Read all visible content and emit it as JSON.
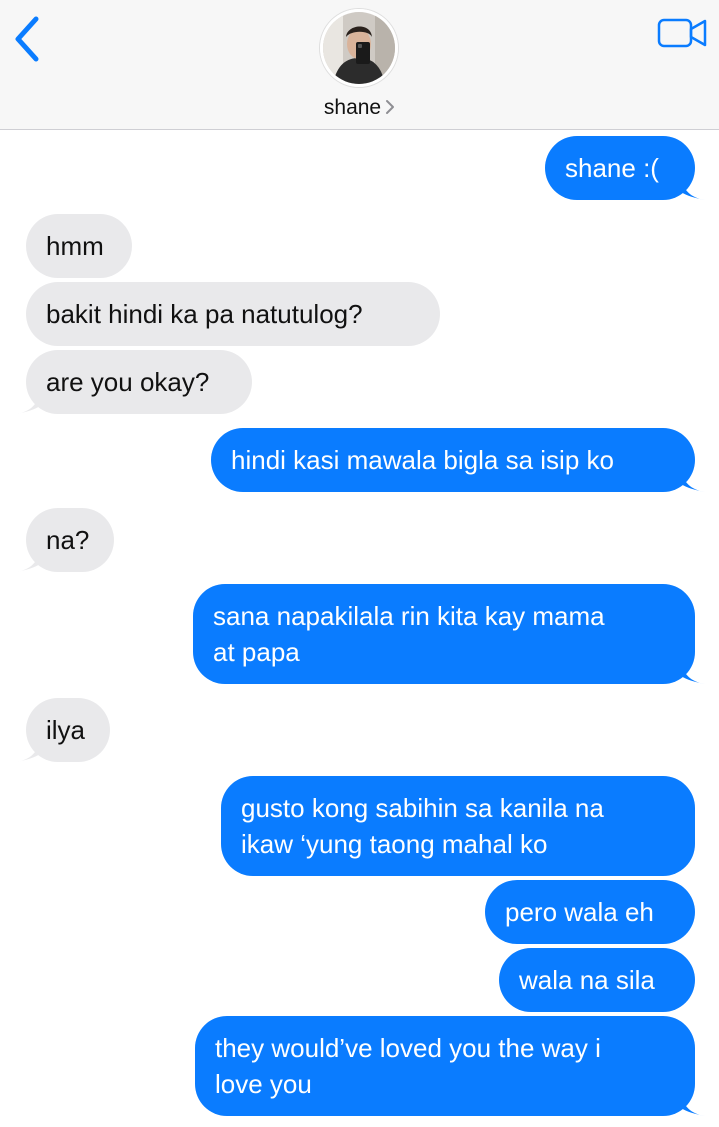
{
  "header": {
    "contact_name": "shane",
    "back_icon": "chevron-left-icon",
    "video_icon": "video-camera-icon",
    "accent_color": "#0a7cff"
  },
  "messages": [
    {
      "sender": "me",
      "text": "shane :("
    },
    {
      "sender": "them",
      "text": "hmm"
    },
    {
      "sender": "them",
      "text": "bakit hindi ka pa natutulog?"
    },
    {
      "sender": "them",
      "text": "are you okay?"
    },
    {
      "sender": "me",
      "text": "hindi kasi mawala bigla sa isip ko"
    },
    {
      "sender": "them",
      "text": "na?"
    },
    {
      "sender": "me",
      "text": "sana napakilala rin kita kay mama\nat papa"
    },
    {
      "sender": "them",
      "text": "ilya"
    },
    {
      "sender": "me",
      "text": "gusto kong sabihin sa kanila na\nikaw ‘yung taong mahal ko"
    },
    {
      "sender": "me",
      "text": "pero wala eh"
    },
    {
      "sender": "me",
      "text": "wala na sila"
    },
    {
      "sender": "me",
      "text": "they would’ve loved you the way i\nlove you"
    }
  ],
  "colors": {
    "sent_bubble": "#0a7cff",
    "received_bubble": "#e9e9eb"
  }
}
